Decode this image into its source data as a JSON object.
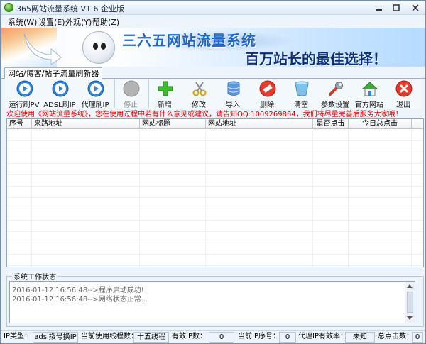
{
  "window": {
    "title": "365网站流量系统  V1.6 企业版"
  },
  "menu": [
    "系统(W)",
    "设置(E)",
    "外观(Y)",
    "帮助(Z)"
  ],
  "banner": {
    "title": "三六五网站流量系统",
    "slogan": "百万站长的最佳选择！"
  },
  "tab": {
    "label": "网站/博客/帖子流量刷新器"
  },
  "toolbar": {
    "buttons": [
      {
        "label": "运行刷PV",
        "icon": "play-icon"
      },
      {
        "label": "ADSL刷IP",
        "icon": "play-icon"
      },
      {
        "label": "代理刷IP",
        "icon": "play-icon"
      },
      {
        "label": "停止",
        "icon": "stop-icon"
      },
      {
        "label": "新增",
        "icon": "plus-icon"
      },
      {
        "label": "修改",
        "icon": "scissors-icon"
      },
      {
        "label": "导入",
        "icon": "database-icon"
      },
      {
        "label": "删除",
        "icon": "delete-icon"
      },
      {
        "label": "清空",
        "icon": "bucket-icon"
      },
      {
        "label": "参数设置",
        "icon": "wrench-icon"
      },
      {
        "label": "官方网站",
        "icon": "house-icon"
      },
      {
        "label": "退出",
        "icon": "exit-icon"
      }
    ]
  },
  "notice": "欢迎使用《网站流量系统》，您在使用过程中若有什么意见或建议，请告知QQ:1009269864，我们将尽量完善后服务大家哦！",
  "table": {
    "columns": [
      "序号",
      "来路地址",
      "网站标题",
      "网站地址",
      "是否点击",
      "今日总点击"
    ],
    "rows": []
  },
  "status_group": {
    "label": "系统工作状态",
    "log": [
      "2016-01-12 16:56:48-->程序启动成功!",
      "2016-01-12 16:56:48-->网络状态正常..."
    ]
  },
  "statusbar": {
    "ip_type_label": "IP类型：",
    "ip_type_value": "adsl拨号换IP",
    "threads_label": "当前使用线程数：",
    "threads_value": "十五线程",
    "valid_ip_label": "有效IP数：",
    "valid_ip_value": "0",
    "ip_seq_label": "当前IP序号：",
    "ip_seq_value": "0",
    "proxy_rate_label": "代理IP有效率：",
    "proxy_rate_value": "未知",
    "total_clicks_label": "总点击数：",
    "total_clicks_value": "0"
  },
  "colors": {
    "accent_blue": "#1f66c9",
    "notice_red": "#e00000",
    "stop_gray": "#aaaaaa"
  }
}
